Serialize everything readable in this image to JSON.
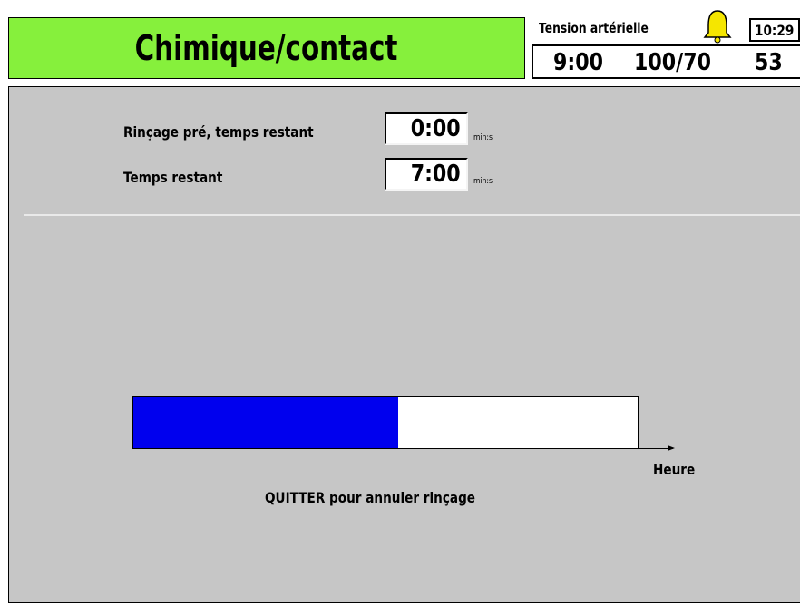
{
  "header": {
    "title": "Chimique/contact",
    "title_bg_color": "#86f03c",
    "bp_label": "Tension artérielle",
    "alarm_icon": "bell-icon",
    "alarm_color": "#f5e600",
    "clock": "10:29",
    "bp_time": "9:00",
    "bp_pressure": "100/70",
    "bp_pulse": "53"
  },
  "rinse": {
    "pre_label": "Rinçage pré, temps restant",
    "pre_value": "0:00",
    "pre_unit": "min:s",
    "remaining_label": "Temps restant",
    "remaining_value": "7:00",
    "remaining_unit": "min:s"
  },
  "progress": {
    "fraction": 0.526,
    "fill_color": "#0000ee",
    "axis_label": "Heure"
  },
  "footer": {
    "hint": "QUITTER pour annuler rinçage"
  }
}
